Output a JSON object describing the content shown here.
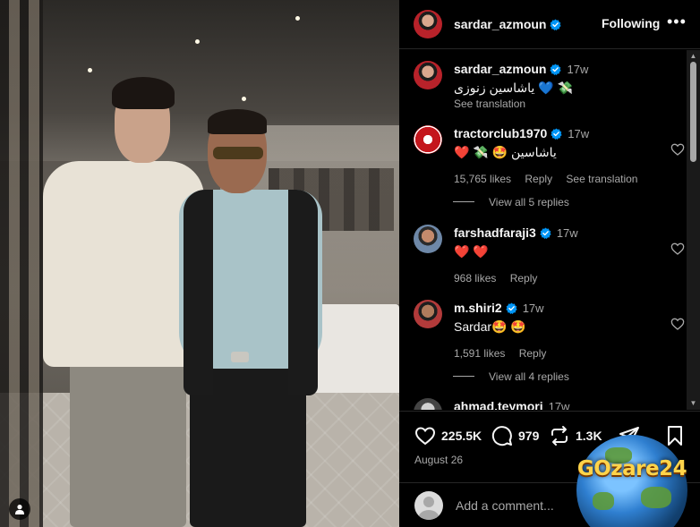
{
  "post": {
    "author": "sardar_azmoun",
    "follow_label": "Following",
    "more_label": "•••"
  },
  "caption": {
    "user": "sardar_azmoun",
    "time": "17w",
    "text": "یاشاسین زنوزی 💙 💸",
    "see_translation": "See translation"
  },
  "comments": [
    {
      "user": "tractorclub1970",
      "verified": true,
      "time": "17w",
      "text": "❤️ 💸 🤩 یاشاسین",
      "likes": "15,765 likes",
      "reply": "Reply",
      "see_translation": "See translation",
      "replies_label": "View all 5 replies"
    },
    {
      "user": "farshadfaraji3",
      "verified": true,
      "time": "17w",
      "text": "❤️ ❤️",
      "likes": "968 likes",
      "reply": "Reply"
    },
    {
      "user": "m.shiri2",
      "verified": true,
      "time": "17w",
      "text": "Sardar🤩 🤩",
      "likes": "1,591 likes",
      "reply": "Reply",
      "replies_label": "View all 4 replies"
    },
    {
      "user": "ahmad.teymori",
      "time": "17w"
    }
  ],
  "actions": {
    "likes_count": "225.5K",
    "comments_count": "979",
    "reposts_count": "1.3K",
    "date": "August 26"
  },
  "add_comment": {
    "placeholder": "Add a comment..."
  },
  "watermark": {
    "text": "GOzare24"
  },
  "icons": {
    "verified": "verified-badge-icon",
    "heart": "heart-icon",
    "comment": "comment-bubble-icon",
    "repost": "repost-icon",
    "share": "send-icon",
    "bookmark": "bookmark-icon",
    "user_tag": "user-tag-icon"
  },
  "colors": {
    "background": "#000000",
    "text": "#f5f5f5",
    "secondary_text": "#a8a8a8",
    "verified": "#0095f6",
    "divider": "#262626"
  }
}
